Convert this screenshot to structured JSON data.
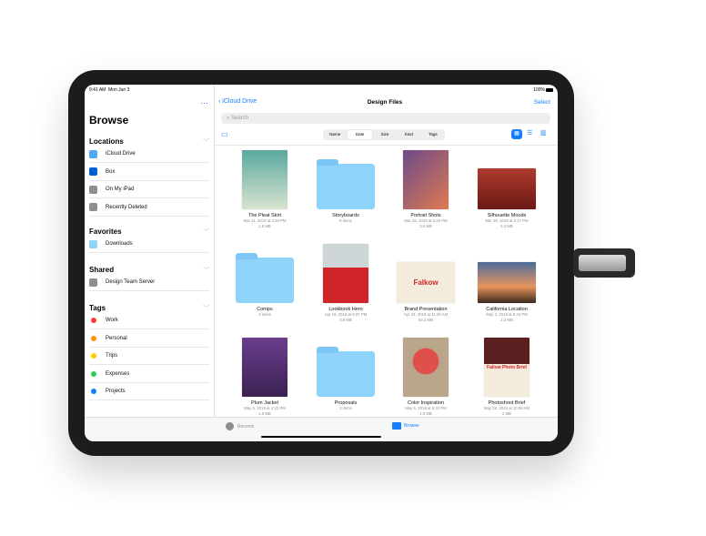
{
  "status": {
    "time": "9:41 AM",
    "date": "Mon Jun 3",
    "battery": "100%"
  },
  "sidebar": {
    "title": "Browse",
    "locations": {
      "header": "Locations",
      "items": [
        {
          "label": "iCloud Drive",
          "color": "#4fa8f5"
        },
        {
          "label": "Box",
          "color": "#0061d5"
        },
        {
          "label": "On My iPad",
          "color": "#8e8e93"
        },
        {
          "label": "Recently Deleted",
          "color": "#8e8e93"
        }
      ]
    },
    "favorites": {
      "header": "Favorites",
      "items": [
        {
          "label": "Downloads",
          "color": "#8fd3fb"
        }
      ]
    },
    "shared": {
      "header": "Shared",
      "items": [
        {
          "label": "Design Team Server",
          "color": "#8e8e93"
        }
      ]
    },
    "tags": {
      "header": "Tags",
      "items": [
        {
          "label": "Work",
          "color": "#ff3b30"
        },
        {
          "label": "Personal",
          "color": "#ff9500"
        },
        {
          "label": "Trips",
          "color": "#ffcc00"
        },
        {
          "label": "Expenses",
          "color": "#34c759"
        },
        {
          "label": "Projects",
          "color": "#147efb"
        }
      ]
    }
  },
  "nav": {
    "back": "iCloud Drive",
    "title": "Design Files",
    "select": "Select",
    "search_placeholder": "Search"
  },
  "sort": {
    "options": [
      "Name",
      "Date",
      "Size",
      "Kind",
      "Tags"
    ],
    "selected": "Date"
  },
  "files": [
    {
      "name": "The Pleat Skirt",
      "line1": "Mar 11, 2019 at 3:28 PM",
      "line2": "2.6 MB",
      "type": "photo",
      "bg": "linear-gradient(#5aa9a0,#d9e3d0)"
    },
    {
      "name": "Storyboards",
      "line1": "8 items",
      "line2": "",
      "type": "folder"
    },
    {
      "name": "Portrait Shots",
      "line1": "Mar 28, 2019 at 5:25 PM",
      "line2": "3.5 MB",
      "type": "photo",
      "bg": "linear-gradient(135deg,#6b4a8a,#e07a50)"
    },
    {
      "name": "Silhouette Moods",
      "line1": "Mar 28, 2019 at 6:17 PM",
      "line2": "5.3 MB",
      "type": "photo",
      "bg": "linear-gradient(#b03a2e,#6a1a14)"
    },
    {
      "name": "Comps",
      "line1": "4 items",
      "line2": "",
      "type": "folder"
    },
    {
      "name": "Lookbook Hero",
      "line1": "Apr 19, 2019 at 9:37 PM",
      "line2": "3.8 MB",
      "type": "photo",
      "bg": "linear-gradient(#cfd6d8 40%,#d0242a 40%)"
    },
    {
      "name": "Brand Presentation",
      "line1": "Apr 23, 2019 at 11:30 AM",
      "line2": "54.1 MB",
      "type": "doc",
      "bg": "#f3ecdc",
      "label": "Falkow"
    },
    {
      "name": "California Location",
      "line1": "May 3, 2019 at 8:42 PM",
      "line2": "2.3 MB",
      "type": "photo",
      "bg": "linear-gradient(#4a6b9a,#e8955a 60%,#3a2a20)"
    },
    {
      "name": "Plum Jacket",
      "line1": "May 5, 2019 at 4:22 PM",
      "line2": "1.6 MB",
      "type": "photo",
      "bg": "linear-gradient(#6a3d8e,#3a2250)"
    },
    {
      "name": "Proposals",
      "line1": "3 items",
      "line2": "",
      "type": "folder"
    },
    {
      "name": "Color Inspiration",
      "line1": "May 6, 2019 at 5:34 PM",
      "line2": "1.9 MB",
      "type": "photo",
      "bg": "radial-gradient(circle at 50% 40%,#e0504a 30%,#b9a68a 32%)"
    },
    {
      "name": "Photoshoot Brief",
      "line1": "May 28, 2019 at 10:08 AM",
      "line2": "2 MB",
      "type": "doc",
      "bg": "linear-gradient(#5a2020 45%,#f3ecdc 45%)",
      "label": "Fallow Photo Brief"
    }
  ],
  "tabbar": {
    "recents": "Recents",
    "browse": "Browse"
  },
  "colors": {
    "accent": "#147efb",
    "folder": "#8fd3fb"
  }
}
